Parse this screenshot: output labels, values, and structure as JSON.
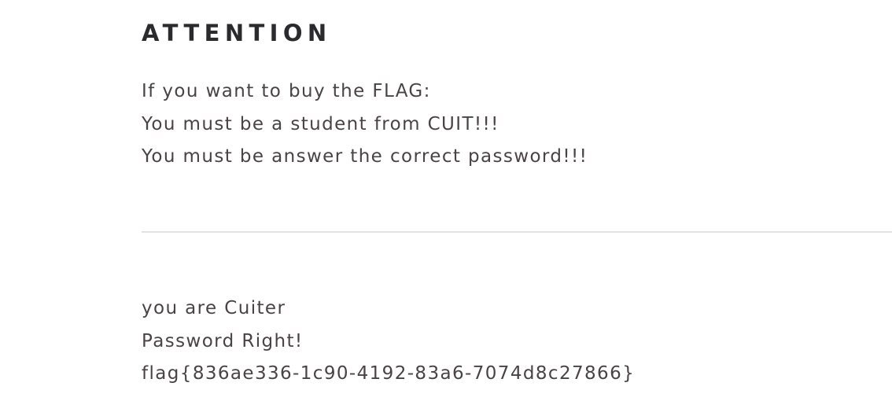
{
  "attention": {
    "heading": "ATTENTION",
    "lines": [
      "If you want to buy the FLAG:",
      "You must be a student from CUIT!!!",
      "You must be answer the correct password!!!"
    ]
  },
  "result": {
    "lines": [
      "you are Cuiter",
      "Password Right!",
      "flag{836ae336-1c90-4192-83a6-7074d8c27866}"
    ]
  },
  "colors": {
    "heading": "#2b2b2e",
    "text": "#4a4346",
    "divider": "#e2e2e2",
    "background": "#ffffff"
  }
}
